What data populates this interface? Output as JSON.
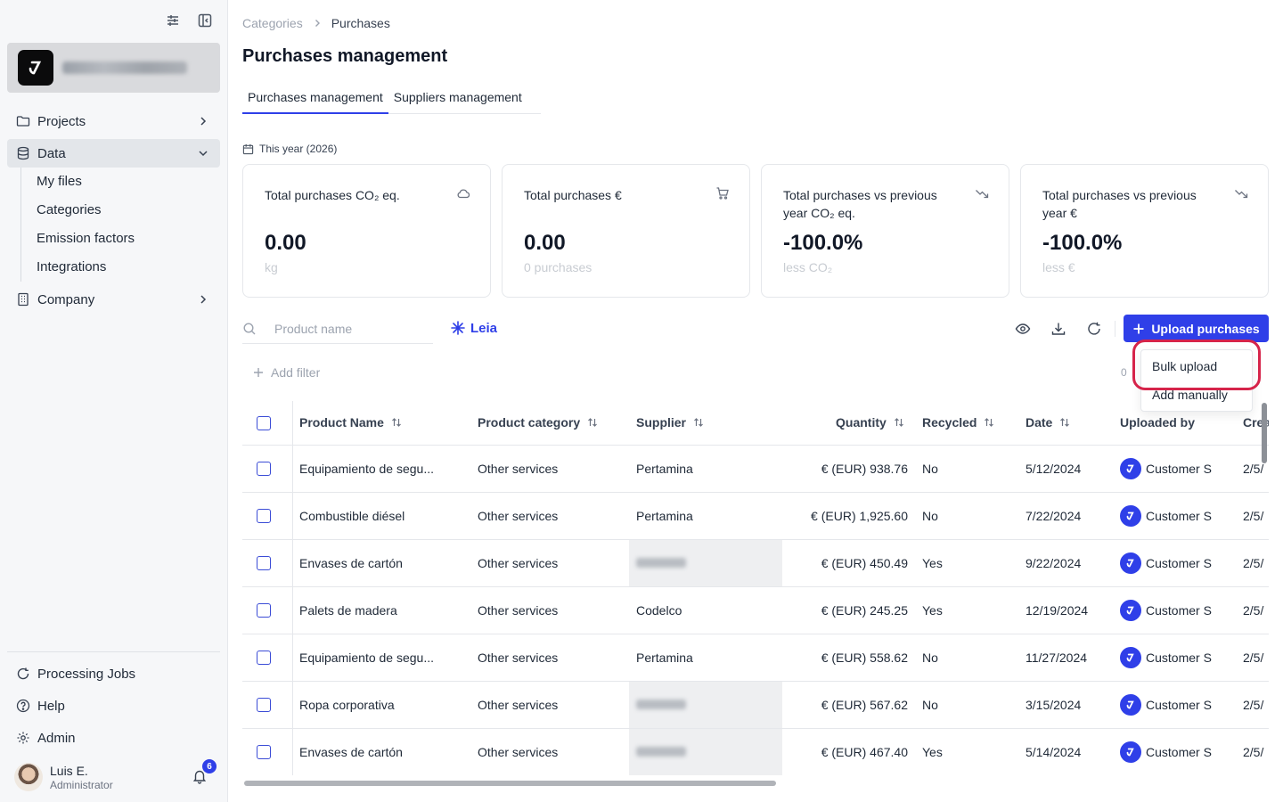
{
  "sidebar": {
    "nav": {
      "projects": "Projects",
      "data": "Data",
      "my_files": "My files",
      "categories": "Categories",
      "emission_factors": "Emission factors",
      "integrations": "Integrations",
      "company": "Company"
    },
    "bottom": {
      "processing_jobs": "Processing Jobs",
      "help": "Help",
      "admin": "Admin"
    },
    "user": {
      "name": "Luis E.",
      "role": "Administrator",
      "notifications": "6"
    }
  },
  "breadcrumb": {
    "parent": "Categories",
    "current": "Purchases"
  },
  "page_title": "Purchases management",
  "tabs": {
    "purchases": "Purchases management",
    "suppliers": "Suppliers management"
  },
  "period": "This year (2026)",
  "cards": [
    {
      "title": "Total purchases CO₂ eq.",
      "value": "0.00",
      "sub": "kg",
      "icon": "cloud-icon"
    },
    {
      "title": "Total purchases €",
      "value": "0.00",
      "sub": "0 purchases",
      "icon": "cart-icon"
    },
    {
      "title": "Total purchases vs previous year CO₂ eq.",
      "value": "-100.0%",
      "sub": "less CO₂",
      "icon": "trend-down-icon"
    },
    {
      "title": "Total purchases vs previous year €",
      "value": "-100.0%",
      "sub": "less €",
      "icon": "trend-down-icon"
    }
  ],
  "toolbar": {
    "search_placeholder": "Product name",
    "leia": "Leia",
    "upload_label": "Upload purchases",
    "add_filter": "Add filter",
    "hidden_count": "0"
  },
  "upload_menu": {
    "bulk": "Bulk upload",
    "manual": "Add manually"
  },
  "table": {
    "headers": {
      "product_name": "Product Name",
      "product_category": "Product category",
      "supplier": "Supplier",
      "quantity": "Quantity",
      "recycled": "Recycled",
      "date": "Date",
      "uploaded_by": "Uploaded by",
      "created": "Crea"
    },
    "rows": [
      {
        "product": "Equipamiento de segu...",
        "category": "Other services",
        "supplier": "Pertamina",
        "quantity": "€ (EUR) 938.76",
        "recycled": "No",
        "date": "5/12/2024",
        "uploaded_by": "Customer S",
        "created": "2/5/"
      },
      {
        "product": "Combustible diésel",
        "category": "Other services",
        "supplier": "Pertamina",
        "quantity": "€ (EUR) 1,925.60",
        "recycled": "No",
        "date": "7/22/2024",
        "uploaded_by": "Customer S",
        "created": "2/5/"
      },
      {
        "product": "Envases de cartón",
        "category": "Other services",
        "supplier": "",
        "quantity": "€ (EUR) 450.49",
        "recycled": "Yes",
        "date": "9/22/2024",
        "uploaded_by": "Customer S",
        "created": "2/5/"
      },
      {
        "product": "Palets de madera",
        "category": "Other services",
        "supplier": "Codelco",
        "quantity": "€ (EUR) 245.25",
        "recycled": "Yes",
        "date": "12/19/2024",
        "uploaded_by": "Customer S",
        "created": "2/5/"
      },
      {
        "product": "Equipamiento de segu...",
        "category": "Other services",
        "supplier": "Pertamina",
        "quantity": "€ (EUR) 558.62",
        "recycled": "No",
        "date": "11/27/2024",
        "uploaded_by": "Customer S",
        "created": "2/5/"
      },
      {
        "product": "Ropa corporativa",
        "category": "Other services",
        "supplier": "",
        "quantity": "€ (EUR) 567.62",
        "recycled": "No",
        "date": "3/15/2024",
        "uploaded_by": "Customer S",
        "created": "2/5/"
      },
      {
        "product": "Envases de cartón",
        "category": "Other services",
        "supplier": "",
        "quantity": "€ (EUR) 467.40",
        "recycled": "Yes",
        "date": "5/14/2024",
        "uploaded_by": "Customer S",
        "created": "2/5/"
      }
    ]
  },
  "colors": {
    "accent": "#2f3fe8",
    "highlight": "#d6244a"
  }
}
